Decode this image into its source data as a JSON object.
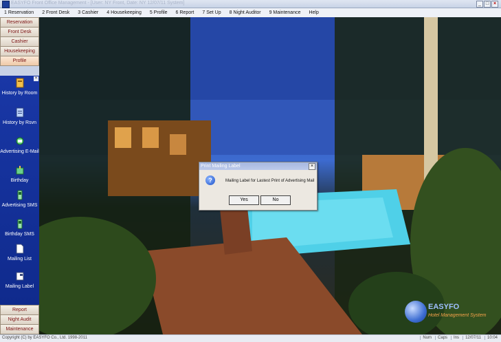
{
  "window": {
    "title": "EASYFO Front Office Management - [User: NY Front, Date: NY 12/07/11 System]",
    "controls": [
      "_",
      "□",
      "×"
    ]
  },
  "menu": [
    "1 Reservation",
    "2 Front Desk",
    "3 Cashier",
    "4 Housekeeping",
    "5 Profile",
    "6 Report",
    "7 Set Up",
    "8 Night Auditor",
    "9 Maintenance",
    "Help"
  ],
  "sidebar": {
    "top_buttons": [
      "Reservation",
      "Front Desk",
      "Cashier",
      "Housekeeping",
      "Profile"
    ],
    "tools": [
      {
        "label": "History by Room",
        "icon": "history-room-icon"
      },
      {
        "label": "History by Rsvn",
        "icon": "history-rsvn-icon"
      },
      {
        "label": "Advertising E-Mail",
        "icon": "email-icon"
      },
      {
        "label": "Birthday",
        "icon": "birthday-icon"
      },
      {
        "label": "Advertising SMS",
        "icon": "phone-icon"
      },
      {
        "label": "Birthday SMS",
        "icon": "phone-icon"
      },
      {
        "label": "Mailing List",
        "icon": "document-icon"
      },
      {
        "label": "Mailing Label",
        "icon": "label-icon"
      }
    ],
    "bottom_buttons": [
      "Report",
      "Night Audit",
      "Maintenance"
    ]
  },
  "dialog": {
    "title": "Print Mailing Label",
    "message": "Mailing Label for Lastest Print of Advertising Mail",
    "yes_label": "Yes",
    "no_label": "No"
  },
  "logo": {
    "brand": "EASYFO",
    "tagline": "Hotel Management System"
  },
  "status": {
    "copyright": "Copyright (C) by EASYFO Co., Ltd. 1998-2011",
    "cells": [
      "Num",
      "Caps",
      "Ins",
      "12/07/11",
      "10:04"
    ]
  },
  "colors": {
    "sidebar_panel": "#1937a6",
    "nav_text": "#7a1010",
    "logo_tag": "#f7a24a"
  }
}
